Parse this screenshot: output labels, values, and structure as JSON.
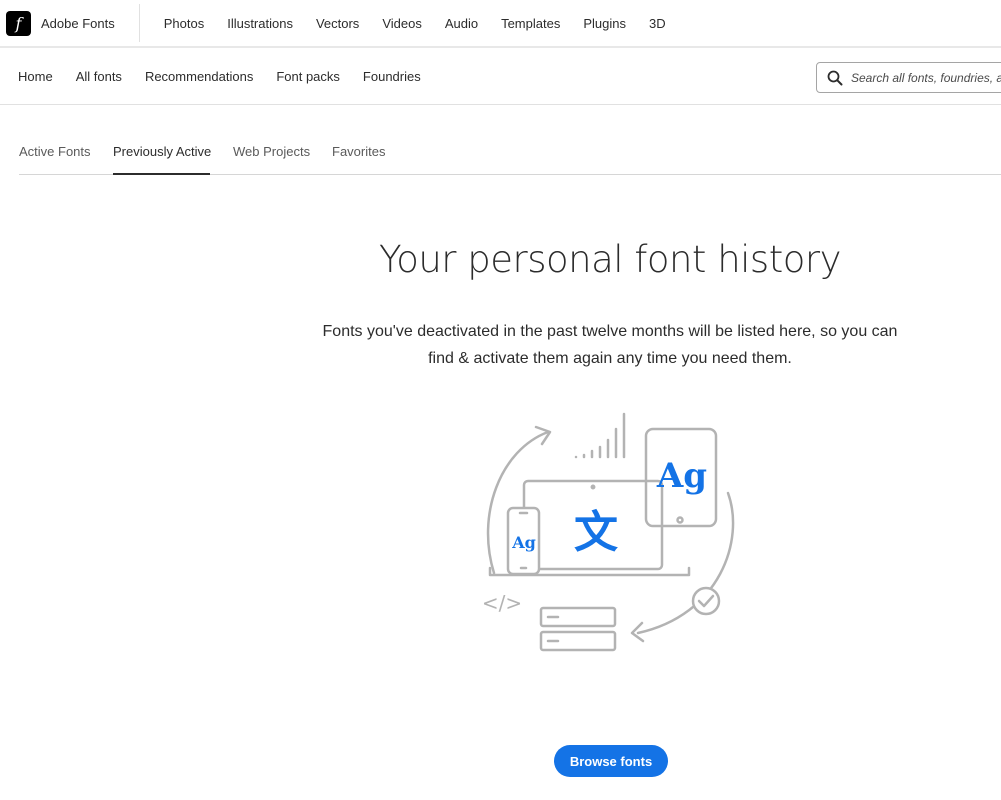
{
  "brand": {
    "logo_glyph": "f",
    "name": "Adobe Fonts"
  },
  "topnav": [
    "Photos",
    "Illustrations",
    "Vectors",
    "Videos",
    "Audio",
    "Templates",
    "Plugins",
    "3D"
  ],
  "subnav": [
    "Home",
    "All fonts",
    "Recommendations",
    "Font packs",
    "Foundries"
  ],
  "search": {
    "placeholder": "Search all fonts, foundries, a",
    "icon": "search-icon"
  },
  "tabs": [
    {
      "label": "Active Fonts",
      "active": false
    },
    {
      "label": "Previously Active",
      "active": true
    },
    {
      "label": "Web Projects",
      "active": false
    },
    {
      "label": "Favorites",
      "active": false
    }
  ],
  "hero": {
    "title": "Your personal font history",
    "description_line1": "Fonts you've deactivated in the past twelve months will be listed here, so you can",
    "description_line2": "find & activate them again any time you need them."
  },
  "illustration": {
    "tablet_glyph": "Ag",
    "laptop_glyph": "文",
    "phone_glyph": "Ag",
    "code_glyph": "</>"
  },
  "browse_button": "Browse fonts",
  "colors": {
    "accent": "#1473e6",
    "line_gray": "#b3b3b3"
  }
}
